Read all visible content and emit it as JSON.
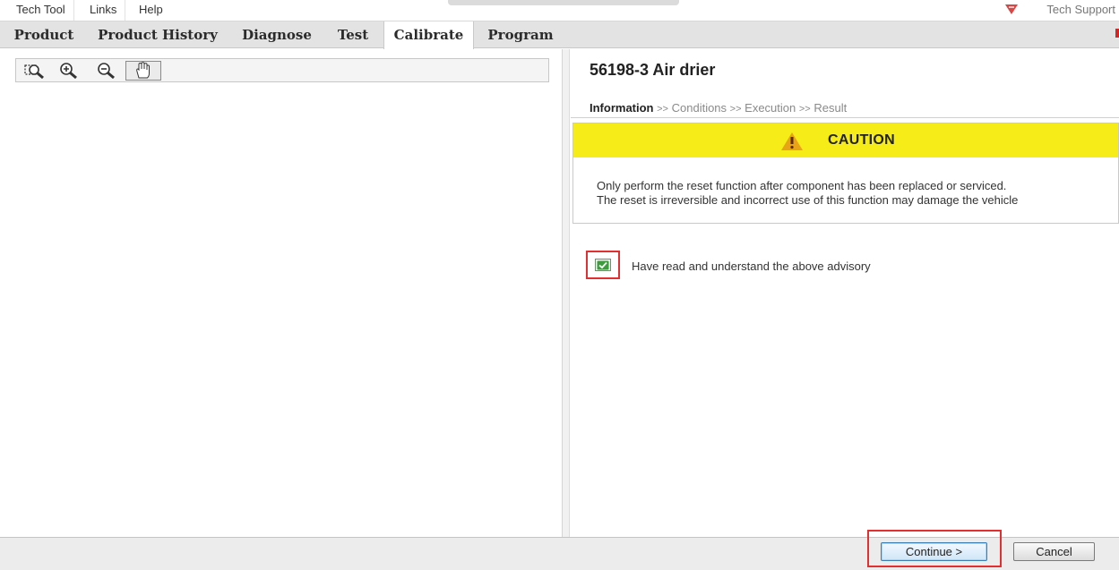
{
  "menu": {
    "items": [
      "Tech Tool",
      "Links",
      "Help"
    ],
    "support_label": "Tech Support"
  },
  "tabs": [
    "Product",
    "Product History",
    "Diagnose",
    "Test",
    "Calibrate",
    "Program"
  ],
  "active_tab": "Calibrate",
  "toolbar_icons": [
    "zoom-area-icon",
    "zoom-in-icon",
    "zoom-out-icon",
    "pan-hand-icon"
  ],
  "panel": {
    "title": "56198-3 Air drier",
    "steps": {
      "current": "Information",
      "separator": ">>",
      "rest": [
        "Conditions",
        "Execution",
        "Result"
      ]
    },
    "caution": {
      "title": "CAUTION",
      "line1": "Only perform the reset function after component has been replaced or serviced.",
      "line2": "The reset is irreversible and incorrect use of this function may damage the vehicle"
    },
    "acknowledge": {
      "label": "Have read and understand the above advisory",
      "checked": true
    }
  },
  "buttons": {
    "continue": "Continue >",
    "cancel": "Cancel"
  },
  "colors": {
    "caution_banner": "#f5ec18",
    "highlight": "#e23030",
    "tab_bar": "#e3e3e3"
  }
}
